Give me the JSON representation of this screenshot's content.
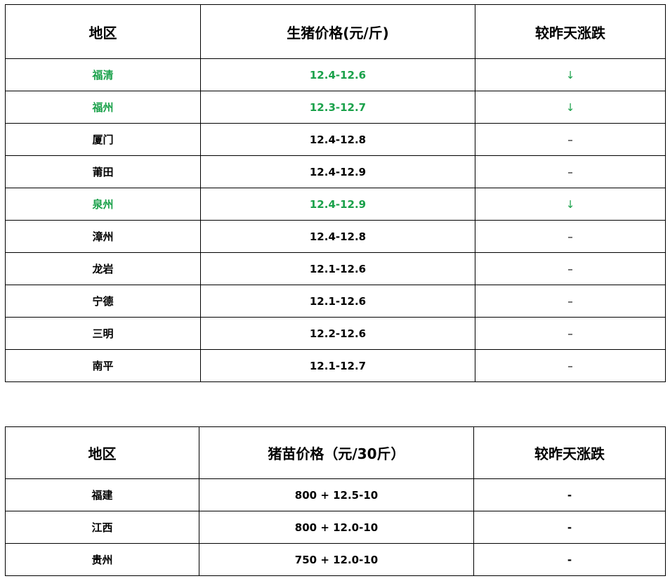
{
  "table1": {
    "headers": [
      "地区",
      "生猪价格(元/斤)",
      "较昨天涨跌"
    ],
    "rows": [
      {
        "region": "福清",
        "price": "12.4-12.6",
        "change": "↓",
        "highlight": true
      },
      {
        "region": "福州",
        "price": "12.3-12.7",
        "change": "↓",
        "highlight": true
      },
      {
        "region": "厦门",
        "price": "12.4-12.8",
        "change": "–",
        "highlight": false
      },
      {
        "region": "莆田",
        "price": "12.4-12.9",
        "change": "–",
        "highlight": false
      },
      {
        "region": "泉州",
        "price": "12.4-12.9",
        "change": "↓",
        "highlight": true
      },
      {
        "region": "漳州",
        "price": "12.4-12.8",
        "change": "–",
        "highlight": false
      },
      {
        "region": "龙岩",
        "price": "12.1-12.6",
        "change": "–",
        "highlight": false
      },
      {
        "region": "宁德",
        "price": "12.1-12.6",
        "change": "–",
        "highlight": false
      },
      {
        "region": "三明",
        "price": "12.2-12.6",
        "change": "–",
        "highlight": false
      },
      {
        "region": "南平",
        "price": "12.1-12.7",
        "change": "–",
        "highlight": false
      }
    ]
  },
  "table2": {
    "headers": [
      "地区",
      "猪苗价格（元/30斤）",
      "较昨天涨跌"
    ],
    "rows": [
      {
        "region": "福建",
        "price": "800 + 12.5-10",
        "change": "-"
      },
      {
        "region": "江西",
        "price": "800 + 12.0-10",
        "change": "-"
      },
      {
        "region": "贵州",
        "price": "750 + 12.0-10",
        "change": "-"
      }
    ]
  },
  "colors": {
    "highlight": "#1aa14a",
    "border": "#000000"
  }
}
